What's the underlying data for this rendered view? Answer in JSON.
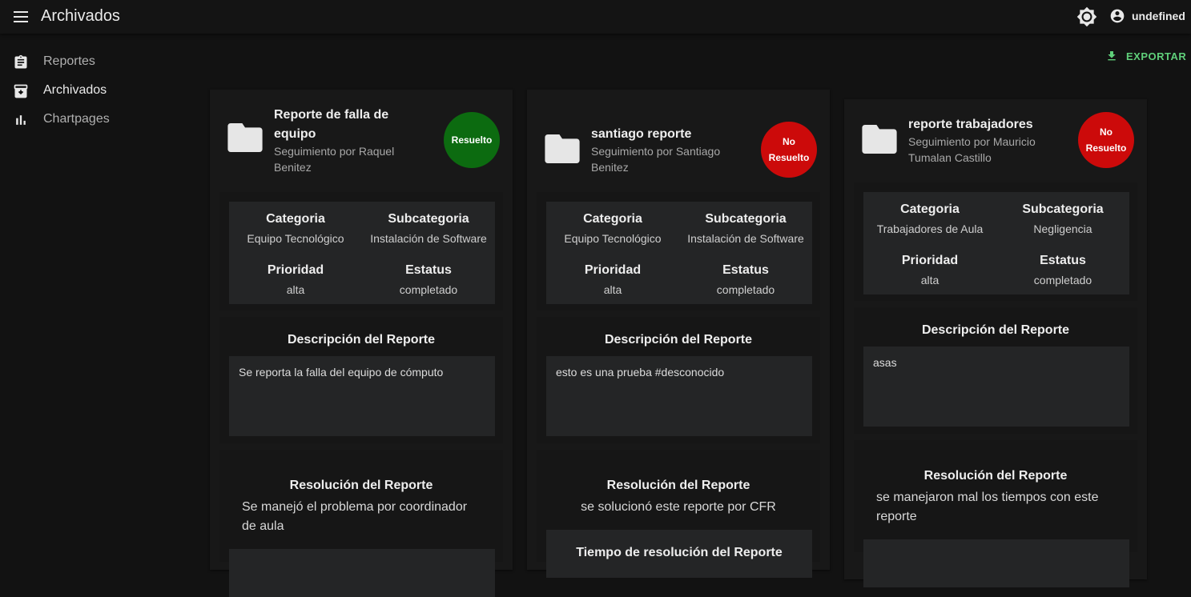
{
  "appbar": {
    "title": "Archivados",
    "user": "undefined"
  },
  "sidebar": {
    "items": [
      {
        "label": "Reportes",
        "icon": "clipboard-icon"
      },
      {
        "label": "Archivados",
        "icon": "archive-icon"
      },
      {
        "label": "Chartpages",
        "icon": "bar-chart-icon"
      }
    ]
  },
  "toolbar": {
    "export_label": "EXPORTAR"
  },
  "labels": {
    "categoria": "Categoria",
    "subcategoria": "Subcategoria",
    "prioridad": "Prioridad",
    "estatus": "Estatus",
    "descripcion": "Descripción del Reporte",
    "resolucion": "Resolución del Reporte",
    "tiempo": "Tiempo de resolución del Reporte"
  },
  "reports": [
    {
      "title": "Reporte de falla de equipo",
      "follow": "Seguimiento por Raquel Benitez",
      "status_badge": "Resuelto",
      "categoria": "Equipo Tecnológico",
      "subcategoria": "Instalación de Software",
      "prioridad": "alta",
      "estatus": "completado",
      "descripcion": "Se reporta la falla del equipo de cómputo",
      "resolucion": "Se manejó el problema por coordinador de aula"
    },
    {
      "title": "santiago reporte",
      "follow": "Seguimiento por Santiago Benitez",
      "status_badge": "No Resuelto",
      "categoria": "Equipo Tecnológico",
      "subcategoria": "Instalación de Software",
      "prioridad": "alta",
      "estatus": "completado",
      "descripcion": "esto es una prueba #desconocido",
      "resolucion": "se solucionó este reporte por CFR"
    },
    {
      "title": "reporte trabajadores",
      "follow": "Seguimiento por Mauricio Tumalan Castillo",
      "status_badge": "No Resuelto",
      "categoria": "Trabajadores de Aula",
      "subcategoria": "Negligencia",
      "prioridad": "alta",
      "estatus": "completado",
      "descripcion": "asas",
      "resolucion": "se manejaron mal los tiempos con este reporte"
    }
  ],
  "colors": {
    "resolved": "#0c6b10",
    "unresolved": "#cc0a0a",
    "accent": "#5fcf7a"
  }
}
